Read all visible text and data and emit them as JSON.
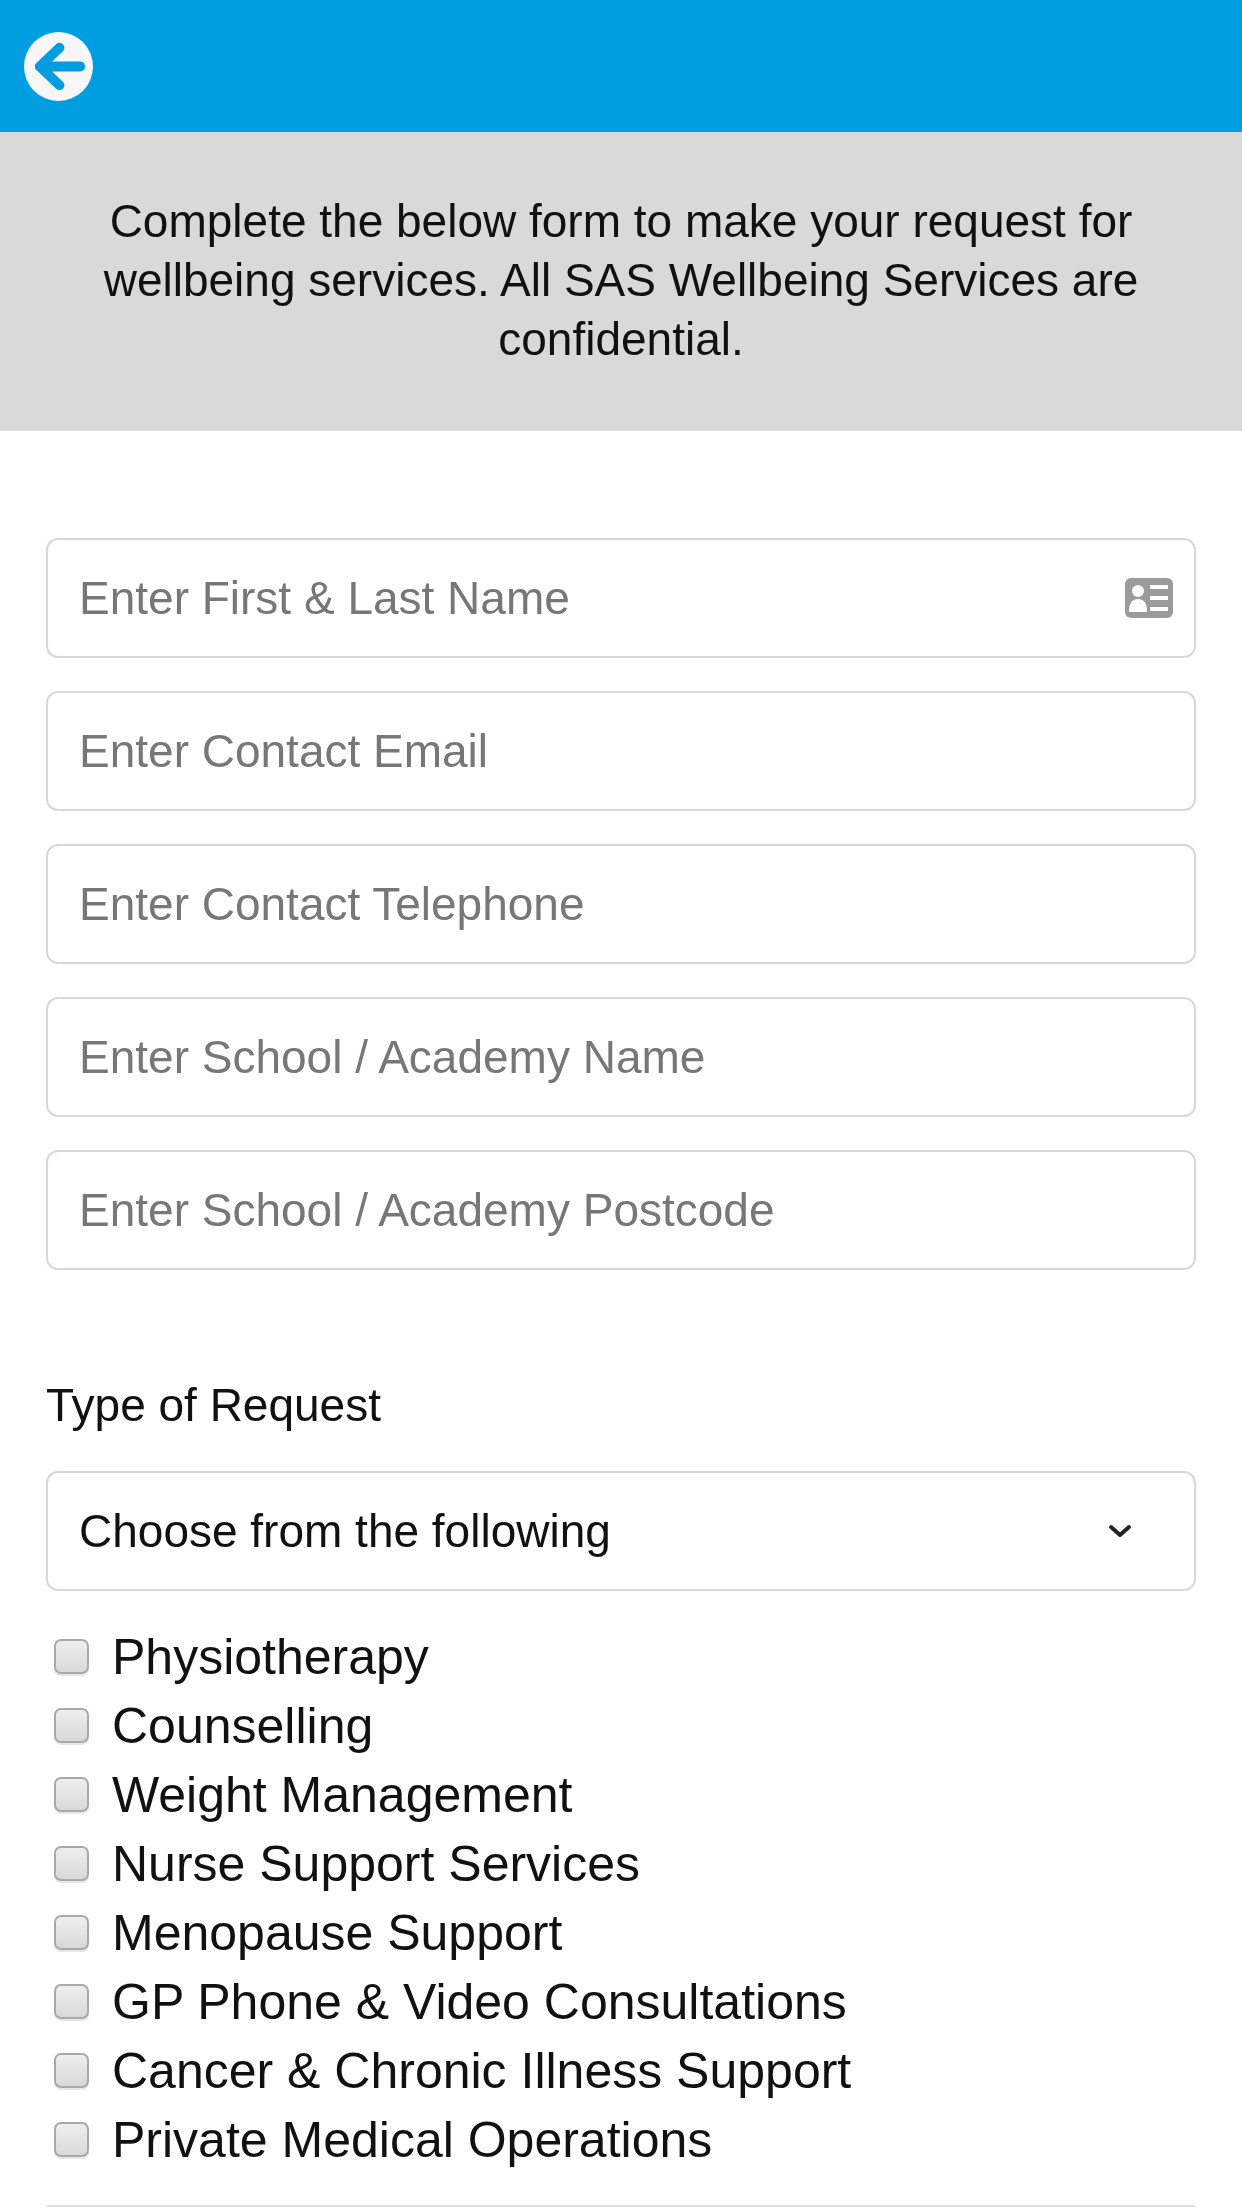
{
  "intro": "Complete the below form to make your request for wellbeing services. All SAS Wellbeing Services are confidential.",
  "fields": [
    {
      "kind": "name",
      "placeholder": "Enter First & Last Name"
    },
    {
      "kind": "email",
      "placeholder": "Enter Contact Email"
    },
    {
      "kind": "phone",
      "placeholder": "Enter Contact Telephone"
    },
    {
      "kind": "school",
      "placeholder": "Enter School / Academy Name"
    },
    {
      "kind": "postcode",
      "placeholder": "Enter School / Academy Postcode"
    }
  ],
  "request_type": {
    "label": "Type of Request",
    "dropdown": {
      "value": "Choose from the following"
    }
  },
  "services": [
    {
      "label": "Physiotherapy",
      "checked": false
    },
    {
      "label": "Counselling",
      "checked": false
    },
    {
      "label": "Weight Management",
      "checked": false
    },
    {
      "label": "Nurse Support Services",
      "checked": false
    },
    {
      "label": "Menopause Support",
      "checked": false
    },
    {
      "label": "GP Phone & Video Consultations",
      "checked": false
    },
    {
      "label": "Cancer & Chronic Illness Support",
      "checked": false
    },
    {
      "label": "Private Medical Operations",
      "checked": false
    }
  ]
}
